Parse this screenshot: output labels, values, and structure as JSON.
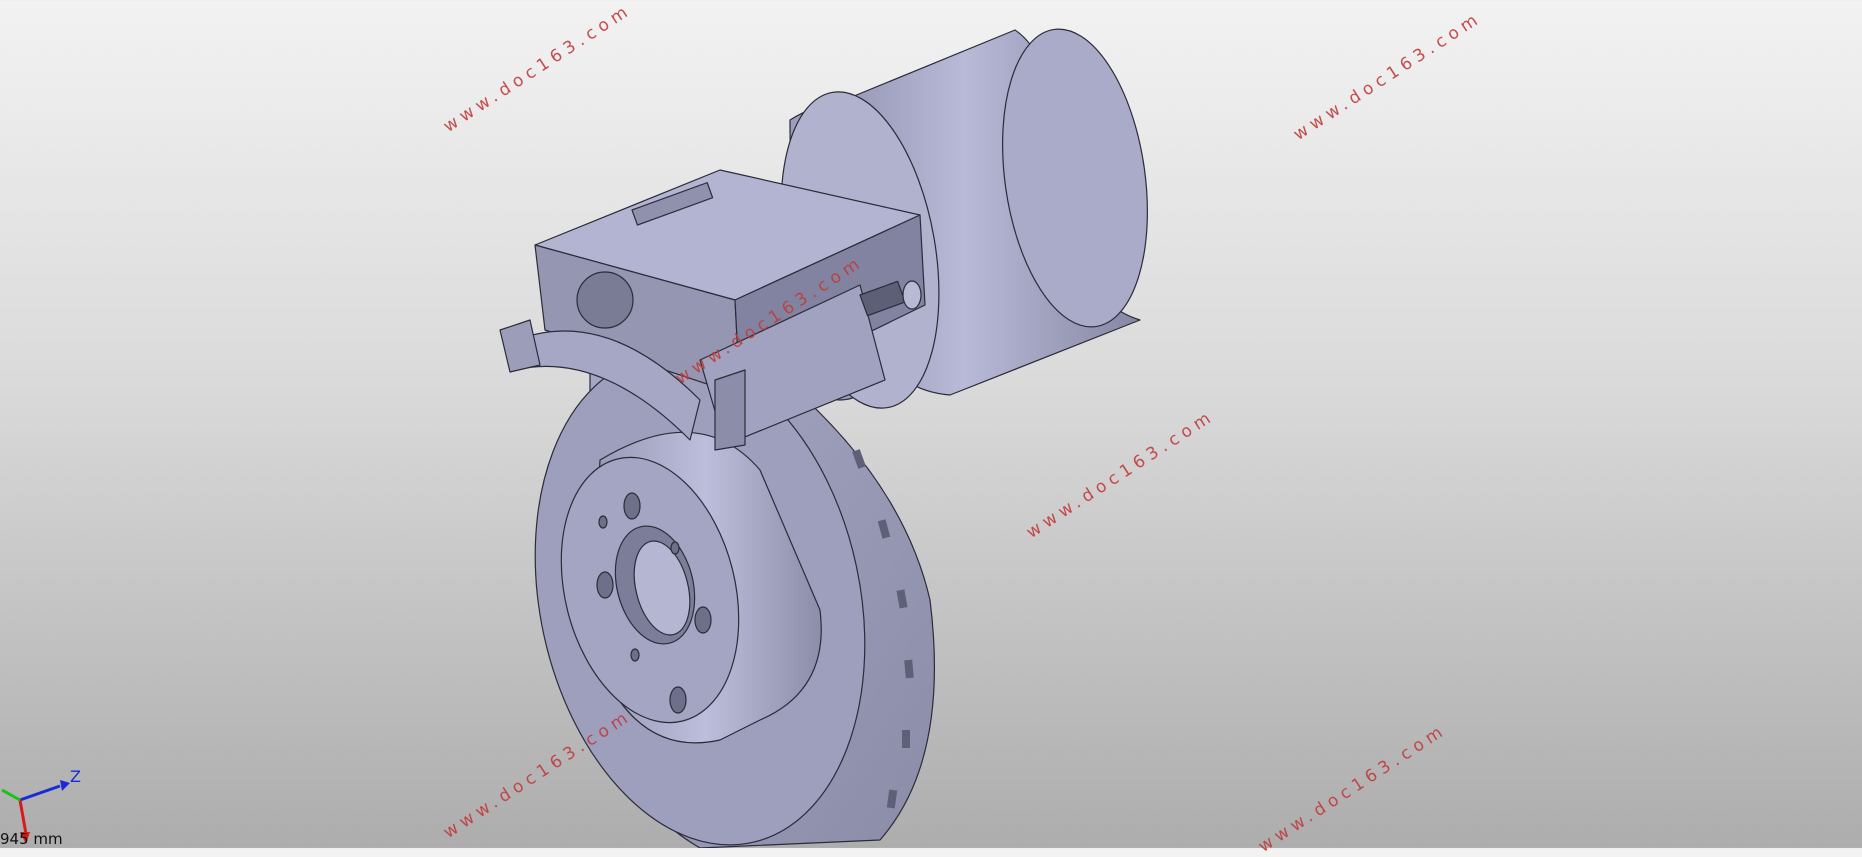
{
  "viewport": {
    "watermark_text": "www.doc163.com",
    "axis_z_label": "Z",
    "scale_text": "945 mm"
  }
}
